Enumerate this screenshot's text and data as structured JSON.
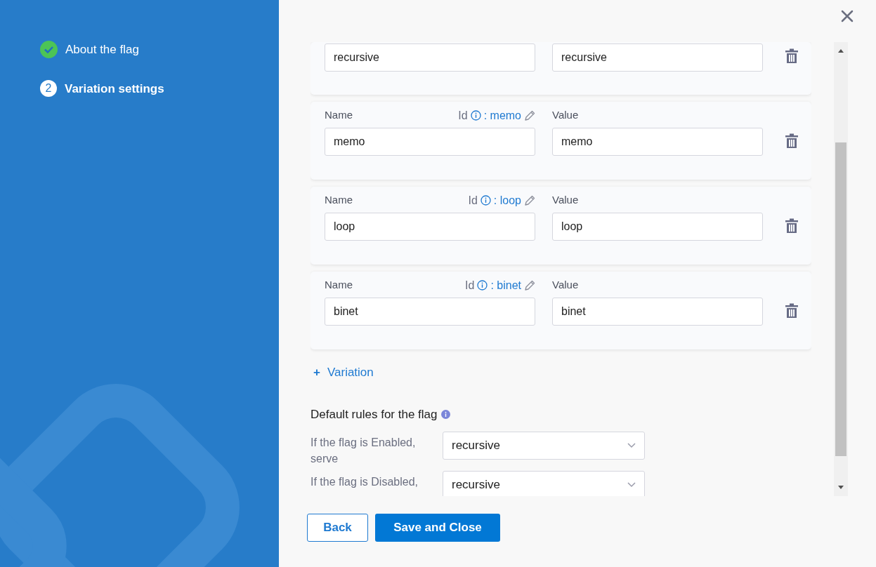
{
  "steps": [
    {
      "label": "About the flag",
      "completed": true,
      "selected": false
    },
    {
      "label": "Variation settings",
      "completed": false,
      "selected": true,
      "number": "2"
    }
  ],
  "variations": [
    {
      "name": "recursive",
      "value": "recursive"
    },
    {
      "name_label": "Name",
      "id_label": "Id",
      "id_separator": ":",
      "id": "memo",
      "value_label": "Value",
      "name": "memo",
      "value": "memo"
    },
    {
      "name_label": "Name",
      "id_label": "Id",
      "id_separator": ":",
      "id": "loop",
      "value_label": "Value",
      "name": "loop",
      "value": "loop"
    },
    {
      "name_label": "Name",
      "id_label": "Id",
      "id_separator": ":",
      "id": "binet",
      "value_label": "Value",
      "name": "binet",
      "value": "binet"
    }
  ],
  "add_variation": {
    "icon": "+",
    "label": "Variation"
  },
  "default_rules": {
    "title": "Default rules for the flag",
    "rules": [
      {
        "label": "If the flag is Enabled, serve",
        "value": "recursive"
      },
      {
        "label": "If the flag is Disabled,",
        "value": "recursive"
      }
    ]
  },
  "buttons": [
    {
      "label": "Back",
      "kind": "secondary"
    },
    {
      "label": "Save and Close",
      "kind": "primary"
    }
  ]
}
